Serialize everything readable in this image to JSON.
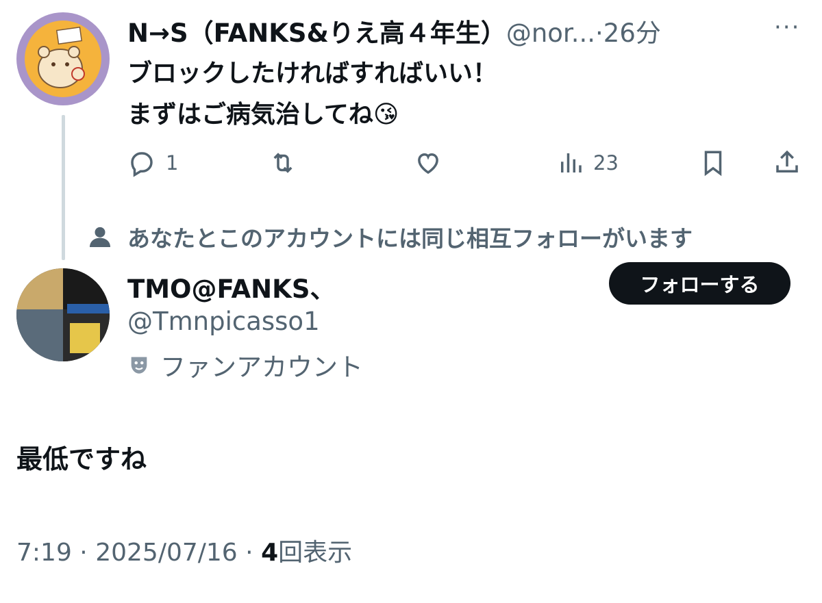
{
  "original_tweet": {
    "display_name": "N→S（FANKS&りえ高４年生）",
    "handle": "@nor...",
    "separator": "·",
    "time_ago": "26分",
    "more_label": "···",
    "text_line1": "ブロックしたければすればいい！",
    "text_line2": "まずはご病気治してね",
    "emoji": "😘",
    "actions": {
      "reply_count": "1",
      "views_count": "23"
    }
  },
  "mutual_notice": "あなたとこのアカウントには同じ相互フォローがいます",
  "reply_user": {
    "display_name": "TMO@FANKS、",
    "handle": "@Tmnpicasso1",
    "label": "ファンアカウント",
    "follow_label": "フォローする"
  },
  "reply_tweet": {
    "text": "最低ですね",
    "time": "7:19",
    "date": "2025/07/16",
    "sep": "·",
    "views_count": "4",
    "views_label": "回表示"
  },
  "colors": {
    "text": "#0f1419",
    "secondary": "#536471",
    "thread_line": "#cfd9de",
    "avatar_ring": "#a995c9",
    "avatar_fill": "#f5b33c"
  }
}
